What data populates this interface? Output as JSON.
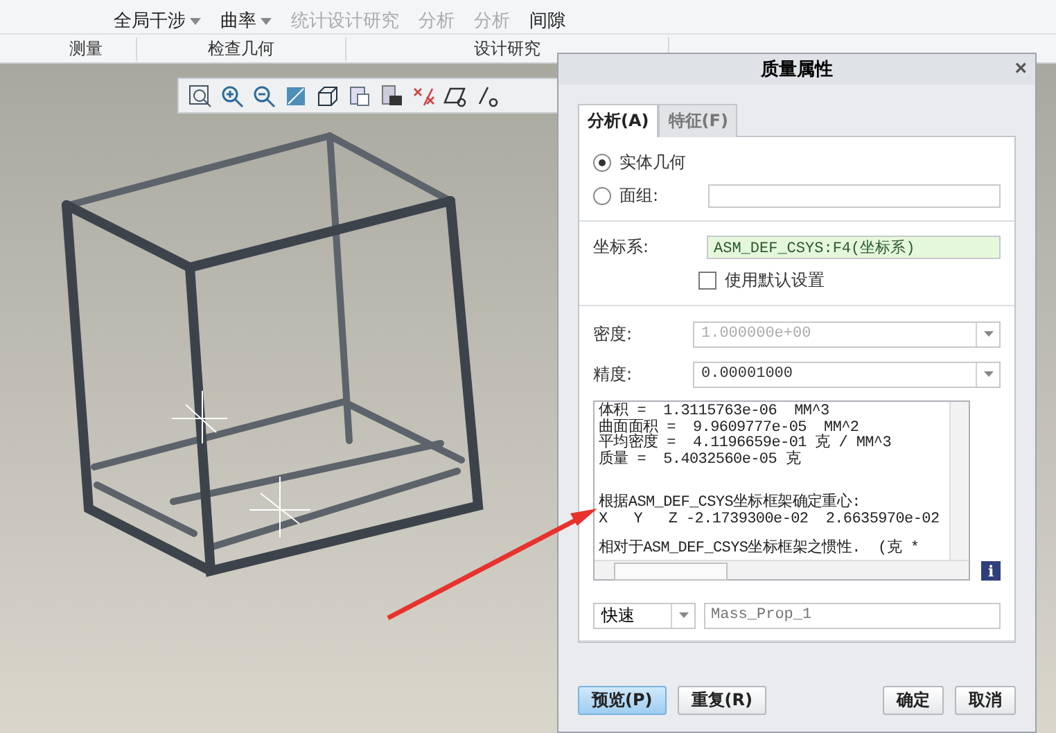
{
  "ribbon": {
    "tools": [
      {
        "label": "全局干涉",
        "disabled": false,
        "kind": "dropdown"
      },
      {
        "label": "曲率",
        "disabled": false,
        "kind": "dropdown"
      },
      {
        "label": "统计设计研究",
        "disabled": true,
        "kind": "plain"
      },
      {
        "label": "分析",
        "disabled": true,
        "kind": "plain"
      },
      {
        "label": "分析",
        "disabled": true,
        "kind": "plain"
      },
      {
        "label": "间隙",
        "disabled": false,
        "kind": "plain"
      }
    ],
    "groups": [
      {
        "label": "测量"
      },
      {
        "label": "检查几何"
      },
      {
        "label": "设计研究"
      }
    ]
  },
  "dialog": {
    "title": "质量属性",
    "close": "×",
    "tabs": [
      {
        "label": "分析(A)",
        "selected": true
      },
      {
        "label": "特征(F)",
        "selected": false
      }
    ],
    "geometry": [
      {
        "label": "实体几何",
        "selected": true
      },
      {
        "label": "面组:",
        "selected": false
      }
    ],
    "csys": {
      "label": "坐标系:",
      "value": "ASM_DEF_CSYS:F4(坐标系)"
    },
    "use_default": {
      "label": "使用默认设置",
      "checked": false
    },
    "density": {
      "label": "密度:",
      "value": "1.000000e+00",
      "disabled": true
    },
    "precision": {
      "label": "精度:",
      "value": "0.00001000",
      "disabled": false
    },
    "results": [
      {
        "lines": [
          "体积 =  1.3115763e-06  MM^3",
          "曲面面积 =  9.9609777e-05  MM^2",
          "平均密度 =  4.1196659e-01 克 / MM^3",
          "质量 =  5.4032560e-05 克"
        ]
      },
      {
        "lines": [
          "根据ASM_DEF_CSYS坐标框架确定重心:",
          "X   Y   Z -2.1739300e-02  2.6635970e-02"
        ]
      },
      {
        "lines": [
          "相对于ASM_DEF_CSYS坐标框架之惯性.  (克 *"
        ]
      }
    ],
    "info": "i",
    "mode": "快速",
    "name_placeholder": "Mass_Prop_1",
    "buttons": [
      {
        "label": "预览(P)",
        "kind": "primary"
      },
      {
        "label": "重复(R)",
        "kind": "normal"
      },
      {
        "label": "确定",
        "kind": "normal"
      },
      {
        "label": "取消",
        "kind": "normal"
      }
    ]
  }
}
